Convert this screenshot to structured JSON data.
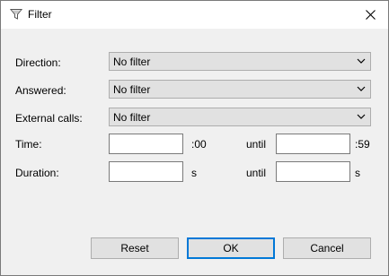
{
  "window": {
    "title": "Filter",
    "icons": {
      "title": "filter-funnel-icon",
      "close": "close-icon"
    }
  },
  "form": {
    "direction": {
      "label": "Direction:",
      "value": "No filter"
    },
    "answered": {
      "label": "Answered:",
      "value": "No filter"
    },
    "external_calls": {
      "label": "External calls:",
      "value": "No filter"
    },
    "time": {
      "label": "Time:",
      "from_value": "",
      "from_suffix": ":00",
      "until_label": "until",
      "until_value": "",
      "until_suffix": ":59"
    },
    "duration": {
      "label": "Duration:",
      "from_value": "",
      "from_suffix": "s",
      "until_label": "until",
      "until_value": "",
      "until_suffix": "s"
    }
  },
  "buttons": {
    "reset": "Reset",
    "ok": "OK",
    "cancel": "Cancel"
  },
  "colors": {
    "focus_border": "#0078d7",
    "button_bg": "#e1e1e1",
    "dialog_bg": "#f0f0f0"
  }
}
